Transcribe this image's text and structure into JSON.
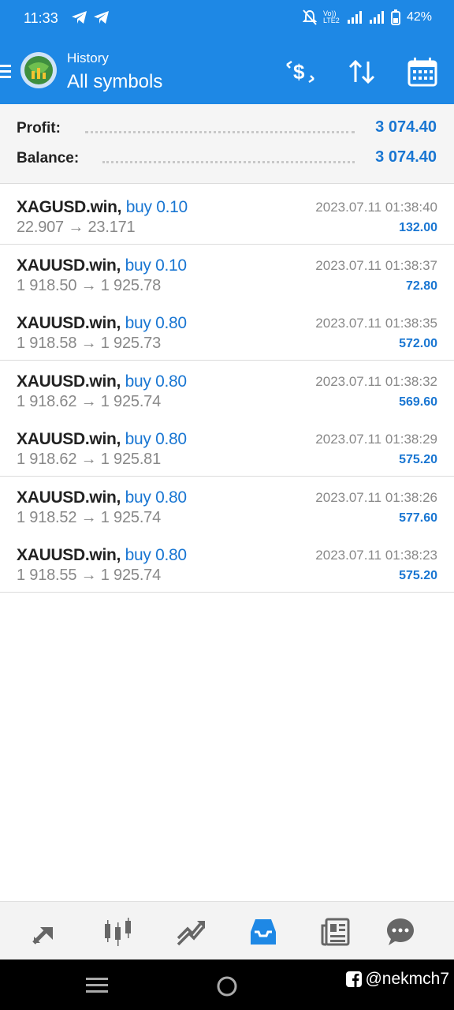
{
  "status_bar": {
    "time": "11:33",
    "network": "Vo)) LTE2",
    "battery": "42%"
  },
  "app_bar": {
    "subtitle": "History",
    "title": "All symbols"
  },
  "summary": {
    "profit_label": "Profit:",
    "profit_value": "3 074.40",
    "balance_label": "Balance:",
    "balance_value": "3 074.40"
  },
  "trades": [
    {
      "symbol": "XAGUSD.win,",
      "side": "buy 0.10",
      "prices": "22.907 → 23.171",
      "time": "2023.07.11 01:38:40",
      "profit": "132.00"
    },
    {
      "symbol": "XAUUSD.win,",
      "side": "buy 0.10",
      "prices": "1 918.50 → 1 925.78",
      "time": "2023.07.11 01:38:37",
      "profit": "72.80"
    },
    {
      "symbol": "XAUUSD.win,",
      "side": "buy 0.80",
      "prices": "1 918.58 → 1 925.73",
      "time": "2023.07.11 01:38:35",
      "profit": "572.00"
    },
    {
      "symbol": "XAUUSD.win,",
      "side": "buy 0.80",
      "prices": "1 918.62 → 1 925.74",
      "time": "2023.07.11 01:38:32",
      "profit": "569.60"
    },
    {
      "symbol": "XAUUSD.win,",
      "side": "buy 0.80",
      "prices": "1 918.62 → 1 925.81",
      "time": "2023.07.11 01:38:29",
      "profit": "575.20"
    },
    {
      "symbol": "XAUUSD.win,",
      "side": "buy 0.80",
      "prices": "1 918.52 → 1 925.74",
      "time": "2023.07.11 01:38:26",
      "profit": "577.60"
    },
    {
      "symbol": "XAUUSD.win,",
      "side": "buy 0.80",
      "prices": "1 918.55 → 1 925.74",
      "time": "2023.07.11 01:38:23",
      "profit": "575.20"
    }
  ],
  "bottom_nav": {
    "items": [
      "quotes-icon",
      "chart-icon",
      "trade-icon",
      "history-icon",
      "news-icon",
      "messages-icon"
    ],
    "active": "history-icon"
  },
  "watermark": "@nekmch7",
  "colors": {
    "accent": "#1e88e5",
    "value_blue": "#1976d2",
    "muted": "#888888"
  }
}
